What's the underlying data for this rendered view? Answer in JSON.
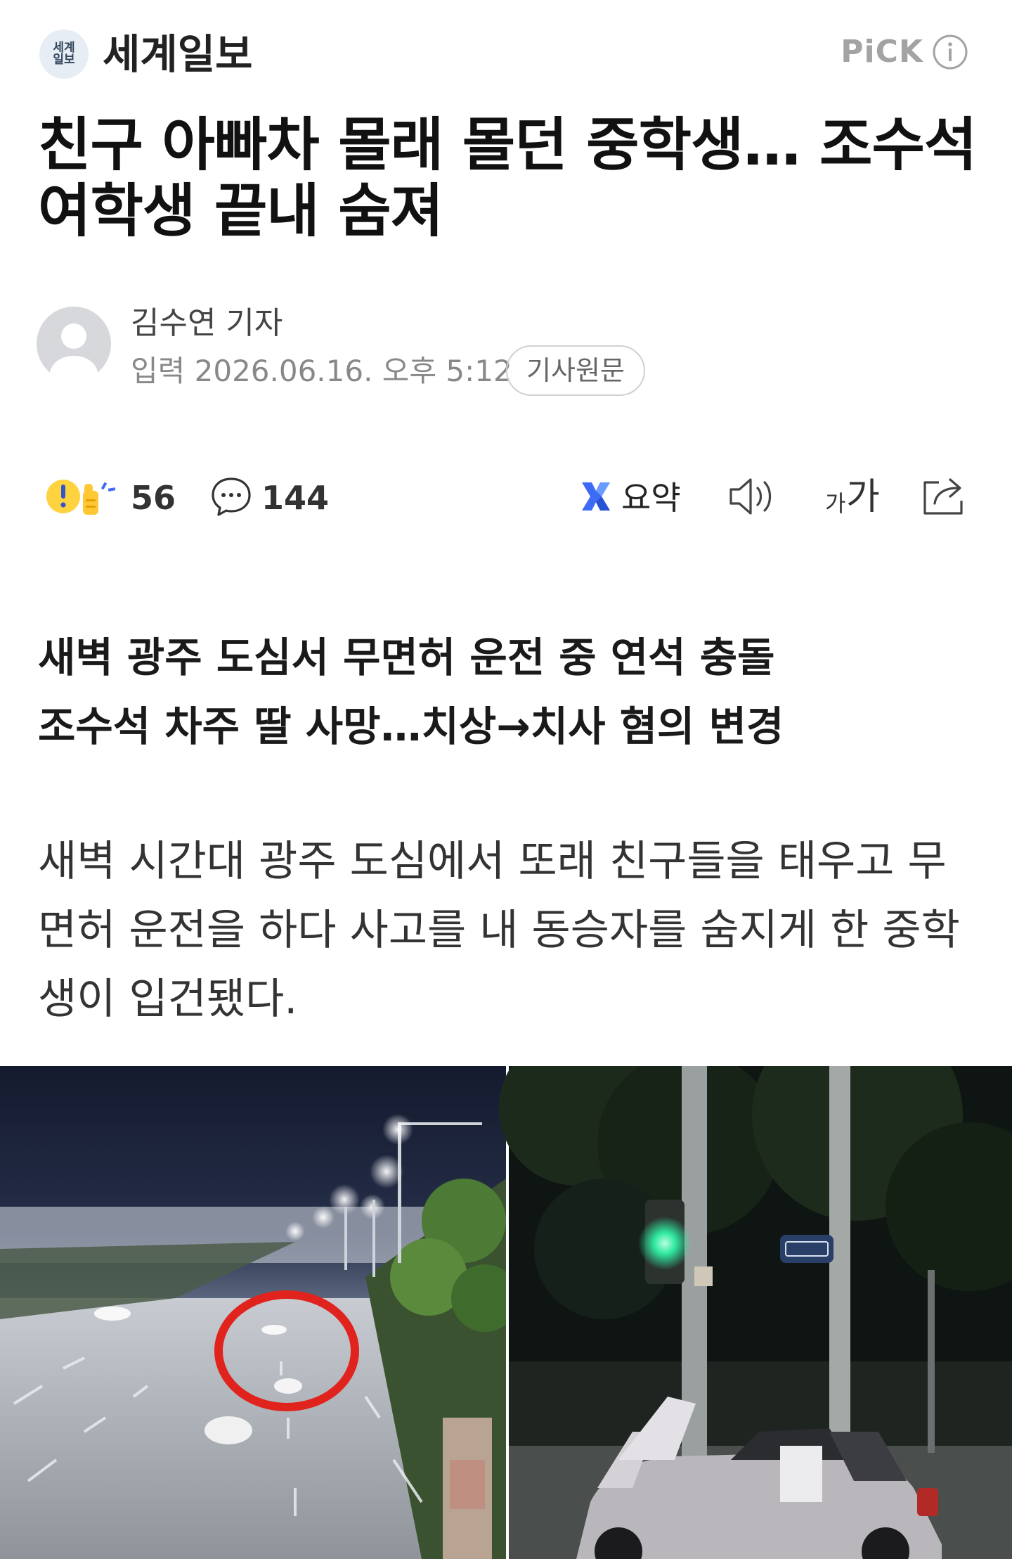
{
  "header": {
    "press_logo_text": "세계\n일보",
    "press_name": "세계일보",
    "pick_label": "PiCK"
  },
  "article": {
    "headline": "친구 아빠차 몰래 몰던 중학생… 조수석 여학생 끝내 숨져",
    "reporter": "김수연 기자",
    "date_label": "입력 2026.06.16. 오후 5:12",
    "original_button": "기사원문",
    "subheadline_line1": "새벽 광주 도심서 무면허 운전 중 연석 충돌",
    "subheadline_line2": "조수석 차주 딸 사망…치상→치사 혐의 변경",
    "body": "새벽 시간대 광주 도심에서 또래 친구들을 태우고 무면허 운전을 하다 사고를 내 동승자를 숨지게 한 중학생이 입건됐다."
  },
  "actions": {
    "reaction_count": "56",
    "comment_count": "144",
    "summary_label": "요약",
    "font_small": "가",
    "font_large": "가"
  },
  "icons": {
    "press_logo": "press-logo",
    "info": "info-icon",
    "avatar": "avatar-icon",
    "reaction": "reaction-icon",
    "comment": "comment-icon",
    "summary": "summary-icon",
    "speaker": "speaker-icon",
    "share": "share-icon"
  },
  "colors": {
    "headline": "#111111",
    "pick": "#a3a3a3",
    "summary_blue": "#3d6bf5",
    "highlight_circle": "#e0241d",
    "traffic_light_green": "#2fe8a0"
  }
}
